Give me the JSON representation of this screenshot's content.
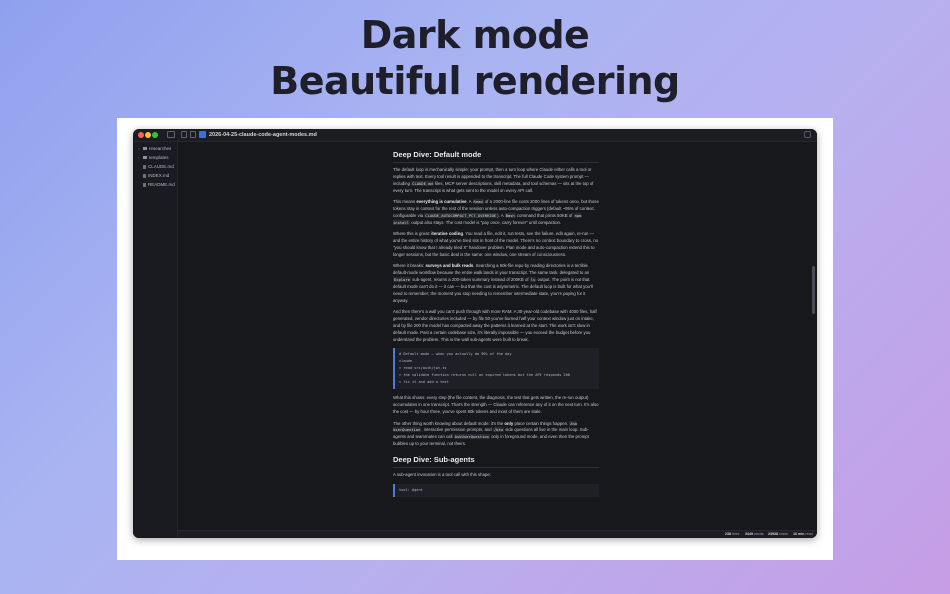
{
  "hero": {
    "line1": "Dark mode",
    "line2": "Beautiful rendering"
  },
  "window": {
    "title": "2026-04-25-claude-code-agent-modes.md",
    "traffic": {
      "close": "#fe5f57",
      "minimize": "#febc2e",
      "zoom": "#28c840"
    }
  },
  "sidebar": {
    "items": [
      {
        "label": "researches",
        "kind": "folder"
      },
      {
        "label": "templates",
        "kind": "folder"
      },
      {
        "label": "CLAUDE.md",
        "kind": "file"
      },
      {
        "label": "INDEX.md",
        "kind": "file"
      },
      {
        "label": "README.md",
        "kind": "file"
      }
    ]
  },
  "doc": {
    "h_default": "Deep Dive: Default mode",
    "p1": [
      "The default loop is mechanically simple: your prompt, then a turn loop where Claude either calls a tool or replies with text. Every tool result is appended to the transcript. The full Claude Code system prompt — including ",
      "CLAUDE.md",
      " files, MCP server descriptions, skill metadata, and tool schemas — sits at the top of every turn. The transcript is what gets sent to the model on every API call."
    ],
    "p2": [
      "This means ",
      "everything is cumulative",
      ". A ",
      "Read",
      " of a 2000-line file costs 2000 lines of tokens once, but those tokens stay in context for the rest of the session unless auto-compaction triggers (default ~95% of context, configurable via ",
      "CLAUDE_AUTOCOMPACT_PCT_OVERRIDE",
      "). A ",
      "Bash",
      " command that prints 50KB of ",
      "npm install",
      " output also stays. The cost model is \"pay once, carry forever\" until compaction."
    ],
    "p3": [
      "Where this is great: ",
      "iterative coding",
      ". You read a file, edit it, run tests, see the failure, edit again, re-run — and the entire history of what you've tried sits in front of the model. There's no context boundary to cross, no \"you should know that I already tried X\" handover problem. Plan mode and auto-compaction extend this to longer sessions, but the basic deal is the same: one window, one stream of consciousness."
    ],
    "p4": [
      "Where it breaks: ",
      "surveys and bulk reads",
      ". Searching a 50k-file repo by reading directories is a terrible default-mode workflow because the entire walk lands in your transcript. The same task, delegated to an ",
      "Explore",
      " sub-agent, returns a 200-token summary instead of 200KB of ",
      "ls",
      " output. The point is not that default mode can't do it — it can — but that the cost is asymmetric. The default loop is built for what you'll need to remember; the moment you stop needing to remember intermediate state, you're paying for it anyway."
    ],
    "p5": "And then there's a wall you can't push through with more RAM. A 30-year-old codebase with 4000 files, half generated, vendor directories included — by file 50 you've burned half your context window just on intake, and by file 200 the model has compacted away the patterns it learned at the start. The work isn't slow in default mode. Past a certain codebase size, it's literally impossible — you exceed the budget before you understand the problem. This is the wall sub-agents were built to break.",
    "code1": [
      "# Default mode — when you actually do 90% of the day",
      "claude",
      "> read src/auth/jwt.ts",
      "> the validate function returns null on expired tokens but the API responds 200",
      "> fix it and add a test"
    ],
    "p6": "What this shows: every step (the file content, the diagnosis, the test that gets written, the re-run output) accumulates in one transcript. That's the strength — Claude can reference any of it on the next turn. It's also the cost — by hour three, you've spent 80k tokens and most of them are stale.",
    "p7": [
      "The other thing worth knowing about default mode: it's the ",
      "only",
      " place certain things happen. ",
      "Ask UserQuestion",
      ", interactive permission prompts, and ",
      "/btw",
      " side questions all live in the main loop. Sub-agents and teammates can call ",
      "AskUserQuestion",
      " only in foreground mode, and even then the prompt bubbles up to your terminal, not theirs."
    ],
    "h_sub": "Deep Dive: Sub-agents",
    "p8": "A sub-agent invocation is a tool call with this shape:",
    "code2": [
      "tool: Agent"
    ]
  },
  "status": {
    "lines_n": "238",
    "lines_l": "lines",
    "words_n": "3449",
    "words_l": "words",
    "chars_n": "23938",
    "chars_l": "chars",
    "read_n": "16 min",
    "read_l": "read"
  }
}
